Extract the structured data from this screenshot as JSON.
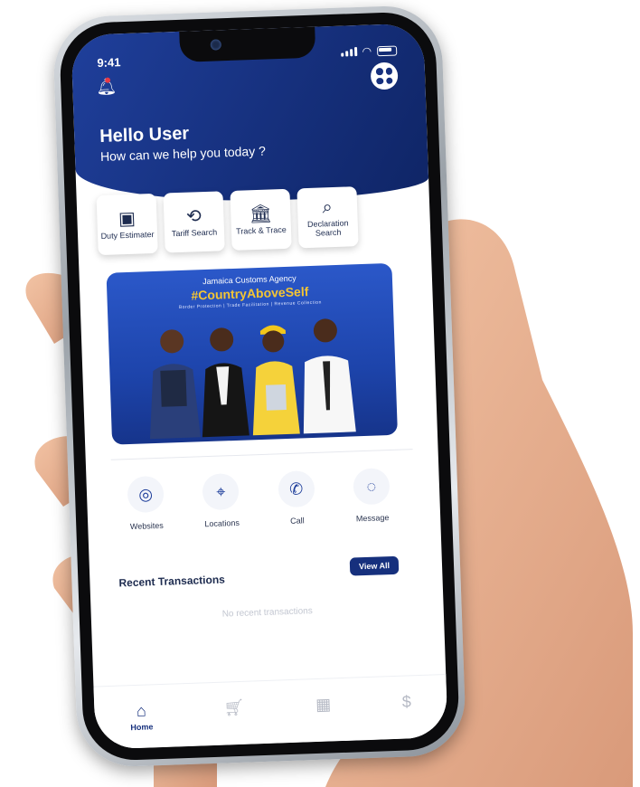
{
  "status_bar": {
    "time": "9:41"
  },
  "header": {
    "greeting": "Hello User",
    "subtitle": "How can we help you today ?"
  },
  "quick_actions": [
    {
      "label": "Duty Estimater",
      "icon": "wallet-icon"
    },
    {
      "label": "Tariff Search",
      "icon": "tariff-icon"
    },
    {
      "label": "Track & Trace",
      "icon": "bank-icon"
    },
    {
      "label": "Declaration Search",
      "icon": "search-icon"
    }
  ],
  "banner": {
    "organization": "Jamaica Customs Agency",
    "hashtag": "#CountryAboveSelf",
    "subtext": "Border Protection | Trade Facilitation | Revenue Collection"
  },
  "contact_options": [
    {
      "label": "Websites",
      "icon": "globe-icon"
    },
    {
      "label": "Locations",
      "icon": "location-pin-icon"
    },
    {
      "label": "Call",
      "icon": "phone-icon"
    },
    {
      "label": "Message",
      "icon": "chat-bubble-icon"
    }
  ],
  "recent_transactions": {
    "title": "Recent Transactions",
    "view_all_label": "View All",
    "empty_message": "No recent transactions"
  },
  "tab_bar": [
    {
      "label": "Home",
      "icon": "home-icon",
      "active": true
    },
    {
      "label": "",
      "icon": "cart-icon",
      "active": false
    },
    {
      "label": "",
      "icon": "grid-icon",
      "active": false
    },
    {
      "label": "",
      "icon": "dollar-icon",
      "active": false
    }
  ],
  "colors": {
    "brand_blue": "#16307d",
    "banner_blue": "#1d44ab",
    "accent_yellow": "#f4c534"
  }
}
